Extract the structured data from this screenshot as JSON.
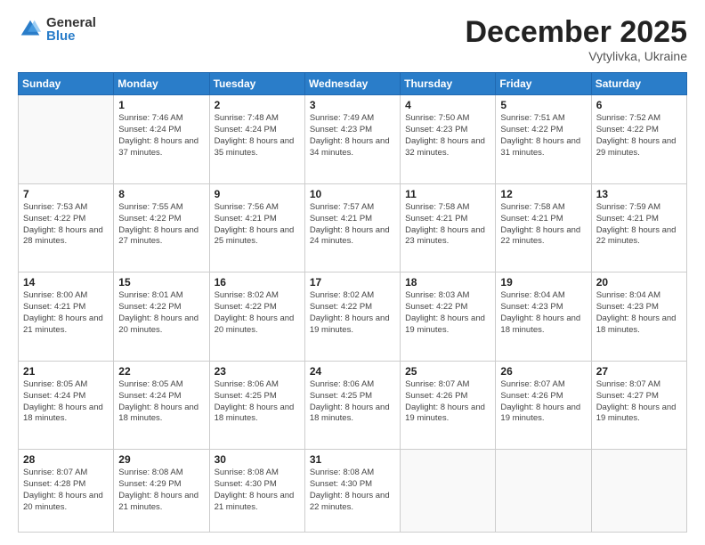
{
  "logo": {
    "general": "General",
    "blue": "Blue"
  },
  "header": {
    "month": "December 2025",
    "location": "Vytylivka, Ukraine"
  },
  "weekdays": [
    "Sunday",
    "Monday",
    "Tuesday",
    "Wednesday",
    "Thursday",
    "Friday",
    "Saturday"
  ],
  "weeks": [
    [
      {
        "day": "",
        "sunrise": "",
        "sunset": "",
        "daylight": ""
      },
      {
        "day": "1",
        "sunrise": "Sunrise: 7:46 AM",
        "sunset": "Sunset: 4:24 PM",
        "daylight": "Daylight: 8 hours and 37 minutes."
      },
      {
        "day": "2",
        "sunrise": "Sunrise: 7:48 AM",
        "sunset": "Sunset: 4:24 PM",
        "daylight": "Daylight: 8 hours and 35 minutes."
      },
      {
        "day": "3",
        "sunrise": "Sunrise: 7:49 AM",
        "sunset": "Sunset: 4:23 PM",
        "daylight": "Daylight: 8 hours and 34 minutes."
      },
      {
        "day": "4",
        "sunrise": "Sunrise: 7:50 AM",
        "sunset": "Sunset: 4:23 PM",
        "daylight": "Daylight: 8 hours and 32 minutes."
      },
      {
        "day": "5",
        "sunrise": "Sunrise: 7:51 AM",
        "sunset": "Sunset: 4:22 PM",
        "daylight": "Daylight: 8 hours and 31 minutes."
      },
      {
        "day": "6",
        "sunrise": "Sunrise: 7:52 AM",
        "sunset": "Sunset: 4:22 PM",
        "daylight": "Daylight: 8 hours and 29 minutes."
      }
    ],
    [
      {
        "day": "7",
        "sunrise": "Sunrise: 7:53 AM",
        "sunset": "Sunset: 4:22 PM",
        "daylight": "Daylight: 8 hours and 28 minutes."
      },
      {
        "day": "8",
        "sunrise": "Sunrise: 7:55 AM",
        "sunset": "Sunset: 4:22 PM",
        "daylight": "Daylight: 8 hours and 27 minutes."
      },
      {
        "day": "9",
        "sunrise": "Sunrise: 7:56 AM",
        "sunset": "Sunset: 4:21 PM",
        "daylight": "Daylight: 8 hours and 25 minutes."
      },
      {
        "day": "10",
        "sunrise": "Sunrise: 7:57 AM",
        "sunset": "Sunset: 4:21 PM",
        "daylight": "Daylight: 8 hours and 24 minutes."
      },
      {
        "day": "11",
        "sunrise": "Sunrise: 7:58 AM",
        "sunset": "Sunset: 4:21 PM",
        "daylight": "Daylight: 8 hours and 23 minutes."
      },
      {
        "day": "12",
        "sunrise": "Sunrise: 7:58 AM",
        "sunset": "Sunset: 4:21 PM",
        "daylight": "Daylight: 8 hours and 22 minutes."
      },
      {
        "day": "13",
        "sunrise": "Sunrise: 7:59 AM",
        "sunset": "Sunset: 4:21 PM",
        "daylight": "Daylight: 8 hours and 22 minutes."
      }
    ],
    [
      {
        "day": "14",
        "sunrise": "Sunrise: 8:00 AM",
        "sunset": "Sunset: 4:21 PM",
        "daylight": "Daylight: 8 hours and 21 minutes."
      },
      {
        "day": "15",
        "sunrise": "Sunrise: 8:01 AM",
        "sunset": "Sunset: 4:22 PM",
        "daylight": "Daylight: 8 hours and 20 minutes."
      },
      {
        "day": "16",
        "sunrise": "Sunrise: 8:02 AM",
        "sunset": "Sunset: 4:22 PM",
        "daylight": "Daylight: 8 hours and 20 minutes."
      },
      {
        "day": "17",
        "sunrise": "Sunrise: 8:02 AM",
        "sunset": "Sunset: 4:22 PM",
        "daylight": "Daylight: 8 hours and 19 minutes."
      },
      {
        "day": "18",
        "sunrise": "Sunrise: 8:03 AM",
        "sunset": "Sunset: 4:22 PM",
        "daylight": "Daylight: 8 hours and 19 minutes."
      },
      {
        "day": "19",
        "sunrise": "Sunrise: 8:04 AM",
        "sunset": "Sunset: 4:23 PM",
        "daylight": "Daylight: 8 hours and 18 minutes."
      },
      {
        "day": "20",
        "sunrise": "Sunrise: 8:04 AM",
        "sunset": "Sunset: 4:23 PM",
        "daylight": "Daylight: 8 hours and 18 minutes."
      }
    ],
    [
      {
        "day": "21",
        "sunrise": "Sunrise: 8:05 AM",
        "sunset": "Sunset: 4:24 PM",
        "daylight": "Daylight: 8 hours and 18 minutes."
      },
      {
        "day": "22",
        "sunrise": "Sunrise: 8:05 AM",
        "sunset": "Sunset: 4:24 PM",
        "daylight": "Daylight: 8 hours and 18 minutes."
      },
      {
        "day": "23",
        "sunrise": "Sunrise: 8:06 AM",
        "sunset": "Sunset: 4:25 PM",
        "daylight": "Daylight: 8 hours and 18 minutes."
      },
      {
        "day": "24",
        "sunrise": "Sunrise: 8:06 AM",
        "sunset": "Sunset: 4:25 PM",
        "daylight": "Daylight: 8 hours and 18 minutes."
      },
      {
        "day": "25",
        "sunrise": "Sunrise: 8:07 AM",
        "sunset": "Sunset: 4:26 PM",
        "daylight": "Daylight: 8 hours and 19 minutes."
      },
      {
        "day": "26",
        "sunrise": "Sunrise: 8:07 AM",
        "sunset": "Sunset: 4:26 PM",
        "daylight": "Daylight: 8 hours and 19 minutes."
      },
      {
        "day": "27",
        "sunrise": "Sunrise: 8:07 AM",
        "sunset": "Sunset: 4:27 PM",
        "daylight": "Daylight: 8 hours and 19 minutes."
      }
    ],
    [
      {
        "day": "28",
        "sunrise": "Sunrise: 8:07 AM",
        "sunset": "Sunset: 4:28 PM",
        "daylight": "Daylight: 8 hours and 20 minutes."
      },
      {
        "day": "29",
        "sunrise": "Sunrise: 8:08 AM",
        "sunset": "Sunset: 4:29 PM",
        "daylight": "Daylight: 8 hours and 21 minutes."
      },
      {
        "day": "30",
        "sunrise": "Sunrise: 8:08 AM",
        "sunset": "Sunset: 4:30 PM",
        "daylight": "Daylight: 8 hours and 21 minutes."
      },
      {
        "day": "31",
        "sunrise": "Sunrise: 8:08 AM",
        "sunset": "Sunset: 4:30 PM",
        "daylight": "Daylight: 8 hours and 22 minutes."
      },
      {
        "day": "",
        "sunrise": "",
        "sunset": "",
        "daylight": ""
      },
      {
        "day": "",
        "sunrise": "",
        "sunset": "",
        "daylight": ""
      },
      {
        "day": "",
        "sunrise": "",
        "sunset": "",
        "daylight": ""
      }
    ]
  ]
}
